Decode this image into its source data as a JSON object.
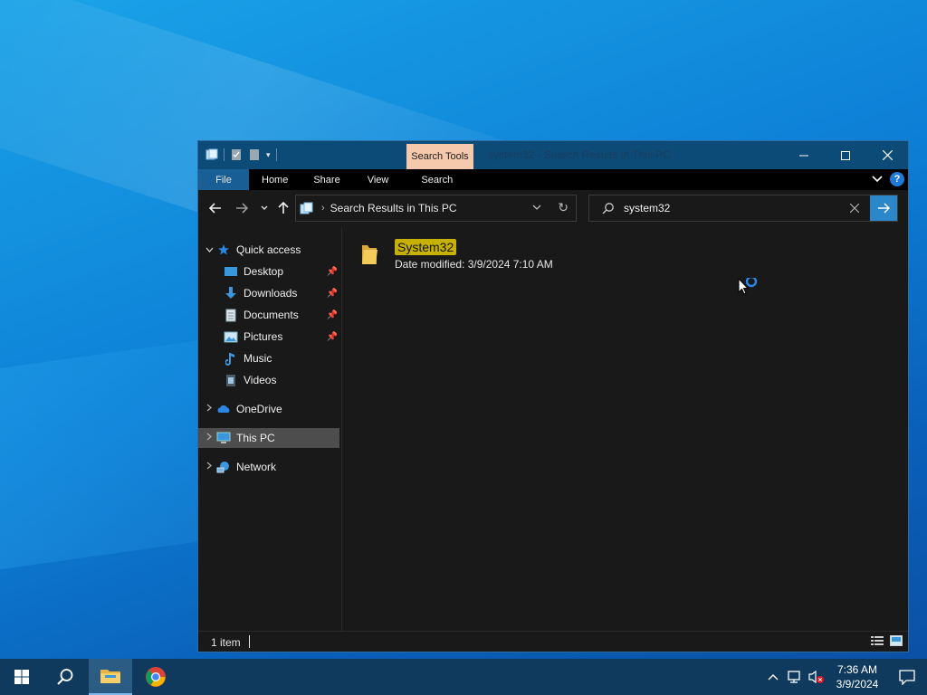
{
  "window": {
    "title": "system32 - Search Results in This PC",
    "contextual_tab": "Search Tools",
    "ribbon_tabs": [
      "File",
      "Home",
      "Share",
      "View",
      "Search"
    ]
  },
  "address": {
    "path": "Search Results in This PC"
  },
  "search": {
    "value": "system32"
  },
  "sidebar": {
    "items": [
      {
        "label": "Quick access",
        "icon": "star-icon"
      },
      {
        "label": "Desktop",
        "icon": "desktop-icon",
        "pinned": true
      },
      {
        "label": "Downloads",
        "icon": "download-icon",
        "pinned": true
      },
      {
        "label": "Documents",
        "icon": "document-icon",
        "pinned": true
      },
      {
        "label": "Pictures",
        "icon": "pictures-icon",
        "pinned": true
      },
      {
        "label": "Music",
        "icon": "music-icon"
      },
      {
        "label": "Videos",
        "icon": "video-icon"
      },
      {
        "label": "OneDrive",
        "icon": "cloud-icon"
      },
      {
        "label": "This PC",
        "icon": "computer-icon",
        "selected": true
      },
      {
        "label": "Network",
        "icon": "network-icon"
      }
    ]
  },
  "results": [
    {
      "name": "System32",
      "meta": "Date modified: 3/9/2024 7:10 AM"
    }
  ],
  "status": {
    "count": "1 item"
  },
  "taskbar": {
    "time": "7:36 AM",
    "date": "3/9/2024"
  },
  "colors": {
    "titlebar": "#0c4a78",
    "search_tools_tab": "#f6c9ad",
    "highlight": "#c7b100",
    "taskbar": "#0f3a5d",
    "accent": "#2b87c9"
  }
}
